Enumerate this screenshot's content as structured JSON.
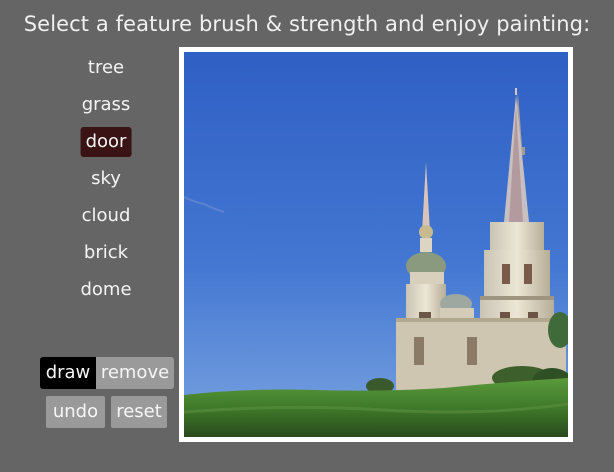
{
  "header": {
    "title": "Select a feature brush & strength and enjoy painting:"
  },
  "brushes": {
    "items": [
      {
        "label": "tree"
      },
      {
        "label": "grass"
      },
      {
        "label": "door"
      },
      {
        "label": "sky"
      },
      {
        "label": "cloud"
      },
      {
        "label": "brick"
      },
      {
        "label": "dome"
      }
    ],
    "selected": "door"
  },
  "tools": {
    "draw_label": "draw",
    "remove_label": "remove",
    "undo_label": "undo",
    "reset_label": "reset",
    "active_mode": "draw"
  },
  "colors": {
    "background": "#656565",
    "selected_brush": "#3a1414",
    "active_button": "#000000",
    "inactive_button": "#9a9a9a",
    "sky": "#3a66c4",
    "grass": "#4f8a34"
  }
}
